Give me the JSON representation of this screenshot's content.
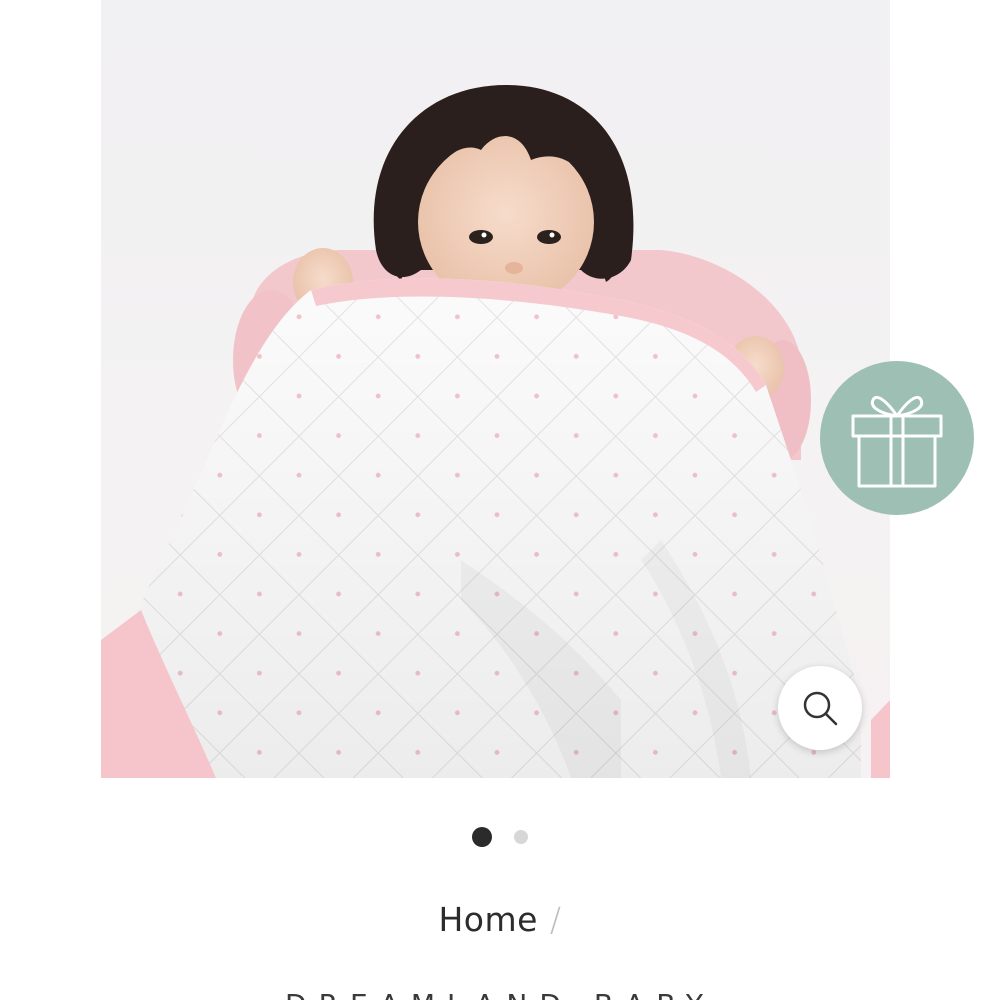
{
  "product_image": {
    "subject": "toddler-holding-quilted-blanket"
  },
  "gift_button": {
    "icon": "gift-icon",
    "color": "#9dbfb4"
  },
  "zoom_button": {
    "icon": "search-icon"
  },
  "carousel": {
    "total": 2,
    "active_index": 0
  },
  "breadcrumb": {
    "home_label": "Home",
    "separator": "/"
  },
  "brand": {
    "name": "DREAMLAND BABY"
  },
  "colors": {
    "accent_sage": "#9dbfb4",
    "dot_active": "#2b2b2b",
    "dot_inactive": "#d7d7d7",
    "blanket_pink": "#f6c9cf"
  }
}
